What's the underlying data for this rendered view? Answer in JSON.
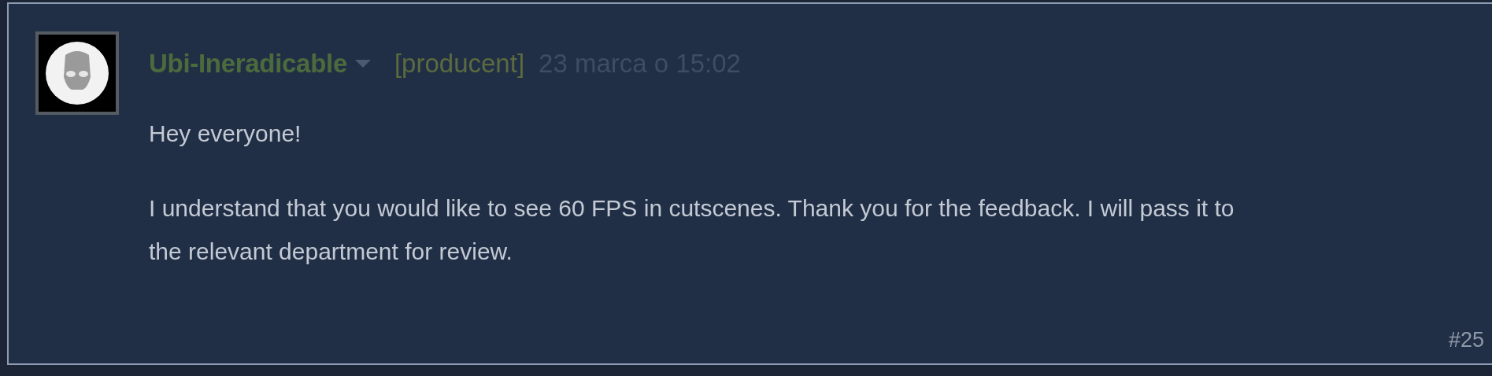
{
  "post": {
    "author": "Ubi-Ineradicable",
    "role": "[producent]",
    "timestamp": "23 marca o 15:02",
    "paragraphs": [
      "Hey everyone!",
      "I understand that you would like to see 60 FPS in cutscenes. Thank you for the feedback. I will pass it to the relevant department for review."
    ],
    "number": "#25"
  }
}
